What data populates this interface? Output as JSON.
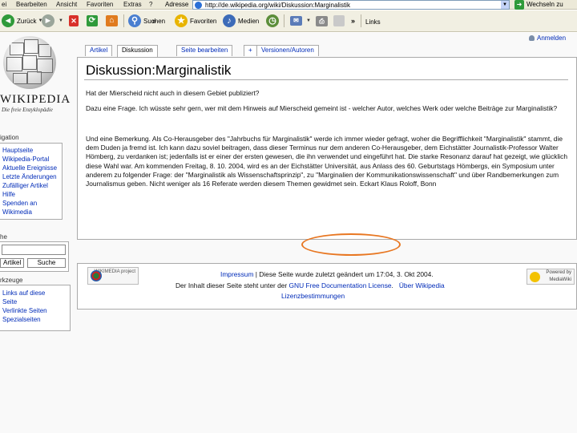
{
  "browser": {
    "menu": [
      "ei",
      "Bearbeiten",
      "Ansicht",
      "Favoriten",
      "Extras",
      "?"
    ],
    "address_label": "Adresse",
    "url": "http://de.wikipedia.org/wiki/Diskussion:Marginalistik",
    "go_label": "Wechseln zu",
    "toolbar": {
      "back": "Zurück",
      "search": "Suchen",
      "favorites": "Favoriten",
      "media": "Medien",
      "links": "Links"
    }
  },
  "wiki": {
    "login": "Anmelden",
    "wordmark": "WIKIPEDIA",
    "tagline": "Die freie Enzyklopädie",
    "nav_title": "igation",
    "nav_items": [
      "Hauptseite",
      "Wikipedia-Portal",
      "Aktuelle Ereignisse",
      "Letzte Änderungen",
      "Zufälliger Artikel",
      "Hilfe",
      "Spenden an",
      "Wikimedia"
    ],
    "search_title": "he",
    "search_buttons": [
      "Artikel",
      "Suche"
    ],
    "tools_title": "rkzeuge",
    "tool_items": [
      "Links auf diese",
      "Seite",
      "Verlinkte Seiten",
      "Spezialseiten"
    ],
    "tabs": [
      "Artikel",
      "Diskussion",
      "Seite bearbeiten",
      "+",
      "Versionen/Autoren"
    ],
    "title": "Diskussion:Marginalistik",
    "paragraphs": [
      "Hat der Mierscheid nicht auch in diesem Gebiet publiziert?",
      "Dazu eine Frage. Ich wüsste sehr gern, wer mit dem Hinweis auf Mierscheid gemeint ist - welcher Autor, welches Werk oder welche Beiträge zur Marginalistik?",
      "Und eine Bemerkung. Als Co-Herausgeber des \"Jahrbuchs für Marginalistik\" werde ich immer wieder gefragt, woher die Begrifflichkeit \"Marginalistik\" stammt, die dem Duden ja fremd ist. Ich kann dazu soviel beitragen, dass dieser Terminus nur dem anderen Co-Herausgeber, dem Eichstätter Journalistik-Professor Walter Hömberg, zu verdanken ist; jedenfalls ist er einer der ersten gewesen, die ihn verwendet und eingeführt hat. Die starke Resonanz darauf hat gezeigt, wie glücklich diese Wahl war. Am kommenden Freitag, 8. 10. 2004, wird es an der Eichstätter Universität, aus Anlass des 60. Geburtstags Hömbergs, ein Symposium unter anderem zu folgender Frage: der \"Marginalistik als Wissenschaftsprinzip\", zu \"Marginalien der Kommunikationswissenschaft\" und über Randbemerkungen zum Journalismus geben. Nicht weniger als 16 Referate werden diesem Themen gewidmet sein. Eckart Klaus Roloff, Bonn"
    ],
    "footer": {
      "line1_link": "Impressum",
      "line1_text": " | Diese Seite wurde zuletzt geändert um 17:04, 3. Okt 2004.",
      "line2_text": "Der Inhalt dieser Seite steht unter der ",
      "line2_link": "GNU Free Documentation License",
      "line2_sep": ".   ",
      "line2_link2": "Über Wikipedia",
      "line3_link": "Lizenzbestimmungen",
      "wikimedia_label": "WIKIMEDIA project",
      "mediawiki_label": "Powered by MediaWiki"
    }
  }
}
